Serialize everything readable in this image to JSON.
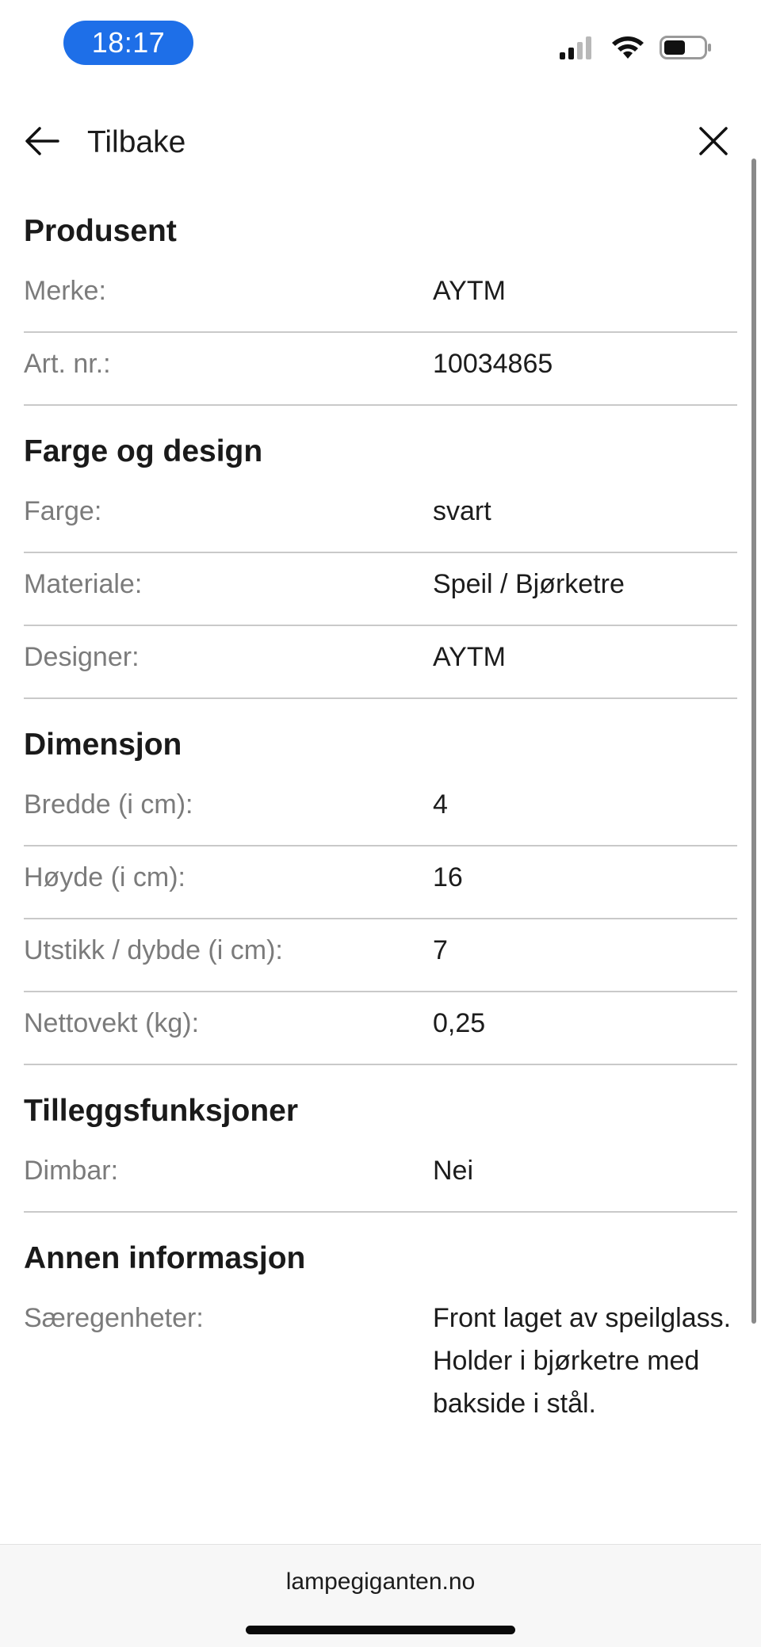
{
  "status_bar": {
    "time": "18:17",
    "signal_icon": "cellular-signal-icon",
    "wifi_icon": "wifi-icon",
    "battery_icon": "battery-icon"
  },
  "header": {
    "back_label": "Tilbake",
    "back_icon": "arrow-left-icon",
    "close_icon": "close-icon"
  },
  "sections": {
    "produsent": {
      "title": "Produsent",
      "rows": [
        {
          "label": "Merke:",
          "value": "AYTM"
        },
        {
          "label": "Art. nr.:",
          "value": "10034865"
        }
      ]
    },
    "farge": {
      "title": "Farge og design",
      "rows": [
        {
          "label": "Farge:",
          "value": "svart"
        },
        {
          "label": "Materiale:",
          "value": "Speil / Bjørketre"
        },
        {
          "label": "Designer:",
          "value": "AYTM"
        }
      ]
    },
    "dimensjon": {
      "title": "Dimensjon",
      "rows": [
        {
          "label": "Bredde (i cm):",
          "value": "4"
        },
        {
          "label": "Høyde (i cm):",
          "value": "16"
        },
        {
          "label": "Utstikk / dybde (i cm):",
          "value": "7"
        },
        {
          "label": "Nettovekt (kg):",
          "value": "0,25"
        }
      ]
    },
    "tillegg": {
      "title": "Tilleggsfunksjoner",
      "rows": [
        {
          "label": "Dimbar:",
          "value": "Nei"
        }
      ]
    },
    "annen": {
      "title": "Annen informasjon",
      "rows": [
        {
          "label": "Særegenheter:",
          "value": "Front laget av speilglass. Holder i bjørketre med bakside i stål."
        }
      ]
    }
  },
  "footer": {
    "url": "lampegiganten.no"
  },
  "colors": {
    "time_pill": "#1e6fe8",
    "label_text": "#7b7b7b",
    "divider": "#c9c9c9"
  }
}
